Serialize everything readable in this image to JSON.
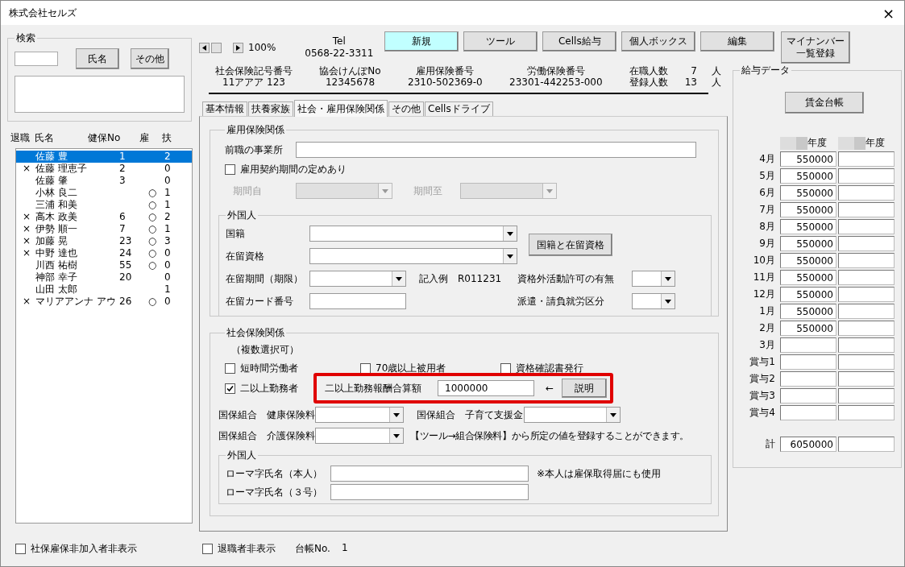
{
  "window": {
    "title": "株式会社セルズ",
    "close": "×"
  },
  "search": {
    "title": "検索",
    "buttons": [
      "氏名",
      "その他"
    ]
  },
  "employee_list": {
    "columns": [
      "退職",
      "氏名",
      "健保No",
      "雇",
      "扶"
    ],
    "rows": [
      {
        "name": "佐藤 豊",
        "health_no": "1",
        "dependents": "2",
        "selected": true
      },
      {
        "retired": "×",
        "name": "佐藤 理恵子",
        "health_no": "2",
        "dependents": "0",
        "selected": false
      },
      {
        "name": "佐藤 肇",
        "health_no": "3",
        "dependents": "0",
        "selected": false
      },
      {
        "name": "小林 良二",
        "employment": "○",
        "dependents": "1",
        "selected": false
      },
      {
        "name": "三浦 和美",
        "employment": "○",
        "dependents": "1",
        "selected": false
      },
      {
        "retired": "×",
        "name": "高木 政美",
        "health_no": "6",
        "employment": "○",
        "dependents": "2",
        "selected": false
      },
      {
        "retired": "×",
        "name": "伊勢 順一",
        "health_no": "7",
        "employment": "○",
        "dependents": "1",
        "selected": false
      },
      {
        "retired": "×",
        "name": "加藤 晃",
        "health_no": "23",
        "employment": "○",
        "dependents": "3",
        "selected": false
      },
      {
        "retired": "×",
        "name": "中野 達也",
        "health_no": "24",
        "employment": "○",
        "dependents": "0",
        "selected": false
      },
      {
        "name": "川西 祐樹",
        "health_no": "55",
        "employment": "○",
        "dependents": "0",
        "selected": false
      },
      {
        "name": "神部 幸子",
        "health_no": "20",
        "dependents": "0",
        "selected": false
      },
      {
        "name": "山田 太郎",
        "dependents": "1",
        "selected": false
      },
      {
        "retired": "×",
        "name": "マリアアンナ アウ",
        "health_no": "26",
        "employment": "○",
        "dependents": "0",
        "selected": false
      }
    ]
  },
  "hide_unenrolled": {
    "label": "社保雇保非加入者非表示",
    "checked": false
  },
  "toolbar": {
    "zoom": "100%",
    "tel_label": "Tel",
    "tel": "0568-22-3311",
    "buttons": [
      {
        "label": "新規",
        "highlighted": true
      },
      {
        "label": "ツール",
        "highlighted": false
      },
      {
        "label": "Cells給与",
        "highlighted": false
      },
      {
        "label": "個人ボックス",
        "highlighted": false
      },
      {
        "label": "編集",
        "highlighted": false
      },
      {
        "label": "マイナンバー一覧登録",
        "highlighted": false
      }
    ]
  },
  "insurance_numbers": [
    {
      "label": "社会保険記号番号",
      "value": "11アアア 123"
    },
    {
      "label": "協会けんぽNo",
      "value": "12345678"
    },
    {
      "label": "雇用保険番号",
      "value": "2310-502369-0"
    },
    {
      "label": "労働保険番号",
      "value": "23301-442253-000"
    }
  ],
  "headcounts": [
    {
      "label": "在職人数",
      "value": "7",
      "unit": "人"
    },
    {
      "label": "登録人数",
      "value": "13",
      "unit": "人"
    }
  ],
  "tabs": [
    {
      "label": "基本情報",
      "selected": false
    },
    {
      "label": "扶養家族",
      "selected": false
    },
    {
      "label": "社会・雇用保険関係",
      "selected": true
    },
    {
      "label": "その他",
      "selected": false
    },
    {
      "label": "Cellsドライブ",
      "selected": false
    }
  ],
  "employment_insurance": {
    "title": "雇用保険関係",
    "previous_office_label": "前職の事業所",
    "fixed_term": {
      "label": "雇用契約期間の定めあり",
      "checked": false
    },
    "period_fields": [
      {
        "label": "期間自",
        "disabled": true
      },
      {
        "label": "期間至",
        "disabled": true
      }
    ],
    "foreign": {
      "title": "外国人",
      "nationality_label": "国籍",
      "status_label": "在留資格",
      "button": "国籍と在留資格",
      "period_label": "在留期間（期限）",
      "example": "記入例　R011231",
      "card_label": "在留カード番号",
      "permission_label": "資格外活動許可の有無",
      "dispatch_label": "派遣・請負就労区分"
    }
  },
  "social_insurance": {
    "title": "社会保険関係",
    "note": "（複数選択可）",
    "checkboxes": [
      {
        "label": "短時間労働者",
        "checked": false
      },
      {
        "label": "70歳以上被用者",
        "checked": false
      },
      {
        "label": "資格確認書発行",
        "checked": false
      },
      {
        "label": "二以上勤務者",
        "checked": true
      }
    ],
    "combined": {
      "label": "二以上勤務報酬合算額",
      "value": "1000000",
      "arrow": "←",
      "button": "説明",
      "highlighted": true
    },
    "union_fields": [
      {
        "label": "国保組合　健康保険料"
      },
      {
        "label": "国保組合　子育て支援金"
      },
      {
        "label": "国保組合　介護保険料"
      }
    ],
    "union_note": "【ツール→組合保険料】から所定の値を登録することができます。",
    "foreign": {
      "title": "外国人",
      "fields": [
        {
          "label": "ローマ字氏名（本人）"
        },
        {
          "label": "ローマ字氏名（３号）"
        }
      ],
      "note": "※本人は雇保取得届にも使用"
    }
  },
  "footer": {
    "hide_retired": {
      "label": "退職者非表示",
      "checked": false
    },
    "ledger_label": "台帳No.",
    "ledger_no": "1"
  },
  "salary": {
    "title": "給与データ",
    "button": "賃金台帳",
    "year_suffixes": [
      "年度",
      "年度"
    ],
    "rows": [
      {
        "label": "4月",
        "current": "550000"
      },
      {
        "label": "5月",
        "current": "550000"
      },
      {
        "label": "6月",
        "current": "550000"
      },
      {
        "label": "7月",
        "current": "550000"
      },
      {
        "label": "8月",
        "current": "550000"
      },
      {
        "label": "9月",
        "current": "550000"
      },
      {
        "label": "10月",
        "current": "550000"
      },
      {
        "label": "11月",
        "current": "550000"
      },
      {
        "label": "12月",
        "current": "550000"
      },
      {
        "label": "1月",
        "current": "550000"
      },
      {
        "label": "2月",
        "current": "550000"
      },
      {
        "label": "3月"
      },
      {
        "label": "賞与1"
      },
      {
        "label": "賞与2"
      },
      {
        "label": "賞与3"
      },
      {
        "label": "賞与4"
      }
    ],
    "total": {
      "label": "計",
      "current": "6050000"
    }
  }
}
